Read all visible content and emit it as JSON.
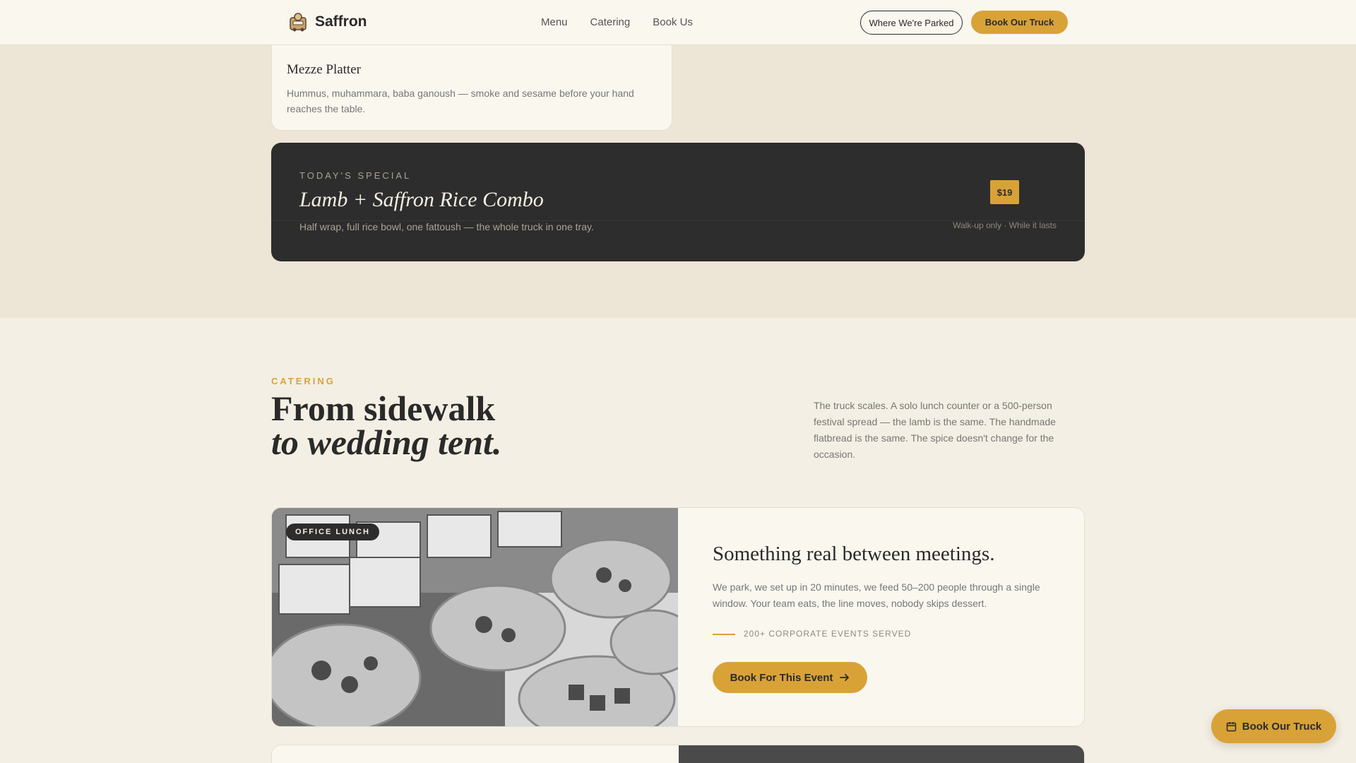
{
  "header": {
    "brand": "Saffron",
    "nav": [
      "Menu",
      "Catering",
      "Book Us"
    ],
    "location_button": "Where We're Parked",
    "cta_button": "Book Our Truck"
  },
  "menu_item": {
    "title": "Mezze Platter",
    "description": "Hummus, muhammara, baba ganoush — smoke and sesame before your hand reaches the table."
  },
  "special": {
    "kicker": "TODAY'S SPECIAL",
    "title": "Lamb + Saffron Rice Combo",
    "description": "Half wrap, full rice bowl, one fattoush — the whole truck in one tray.",
    "price": "$19",
    "note": "Walk-up only · While it lasts"
  },
  "catering": {
    "kicker": "CATERING",
    "title_line1": "From sidewalk",
    "title_line2": "to wedding tent.",
    "description": "The truck scales. A solo lunch counter or a 500-person festival spread — the lamb is the same. The handmade flatbread is the same. The spice doesn't change for the occasion."
  },
  "feature": {
    "badge": "OFFICE LUNCH",
    "title": "Something real between meetings.",
    "description": "We park, we set up in 20 minutes, we feed 50–200 people through a single window. Your team eats, the line moves, nobody skips dessert.",
    "stat": "200+ CORPORATE EVENTS SERVED",
    "button": "Book For This Event"
  },
  "floating_button": "Book Our Truck",
  "colors": {
    "accent": "#d9a237",
    "dark": "#2d2d2d",
    "background": "#f4efe4"
  }
}
